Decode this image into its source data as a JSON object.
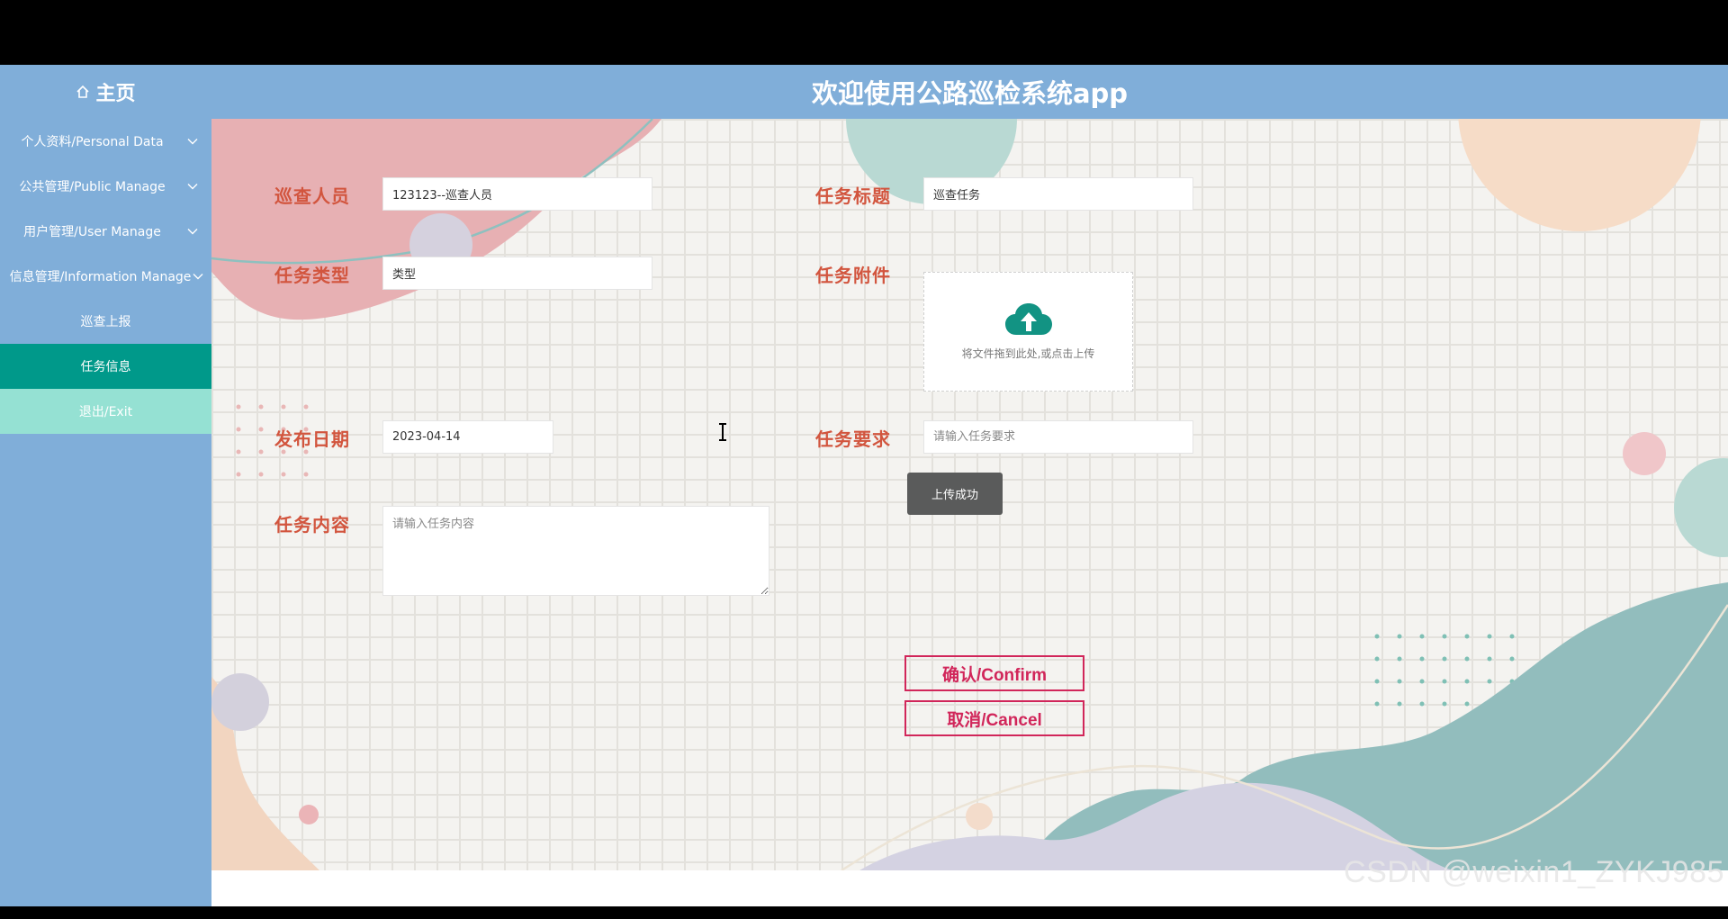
{
  "header": {
    "home_label": "主页",
    "app_title": "欢迎使用公路巡检系统app"
  },
  "sidebar": {
    "items": [
      {
        "label": "个人资料/Personal Data"
      },
      {
        "label": "公共管理/Public Manage"
      },
      {
        "label": "用户管理/User Manage"
      },
      {
        "label": "信息管理/Information Manage"
      },
      {
        "label": "巡查上报"
      },
      {
        "label": "任务信息"
      },
      {
        "label": "退出/Exit"
      }
    ]
  },
  "form": {
    "inspector_label": "巡查人员",
    "inspector_value": "123123--巡查人员",
    "task_title_label": "任务标题",
    "task_title_value": "巡查任务",
    "task_type_label": "任务类型",
    "task_type_value": "类型",
    "attachment_label": "任务附件",
    "upload_text": "将文件拖到此处,或点击上传",
    "publish_date_label": "发布日期",
    "publish_date_value": "2023-04-14",
    "requirement_label": "任务要求",
    "requirement_placeholder": "请输入任务要求",
    "content_label": "任务内容",
    "content_placeholder": "请输入任务内容"
  },
  "toast": {
    "text": "上传成功"
  },
  "actions": {
    "confirm_label": "确认/Confirm",
    "cancel_label": "取消/Cancel"
  },
  "watermark": "CSDN @weixin1_ZYKJ985",
  "colors": {
    "header_bg": "#80aed9",
    "active_item": "#00998a",
    "exit_item": "#95e1d3",
    "label_red": "#d2553e",
    "button_red": "#d1265a",
    "upload_icon": "#129383"
  },
  "icons": {
    "home": "home-icon",
    "chevron": "chevron-down-icon",
    "upload": "cloud-upload-icon",
    "cursor": "text-cursor-icon"
  }
}
